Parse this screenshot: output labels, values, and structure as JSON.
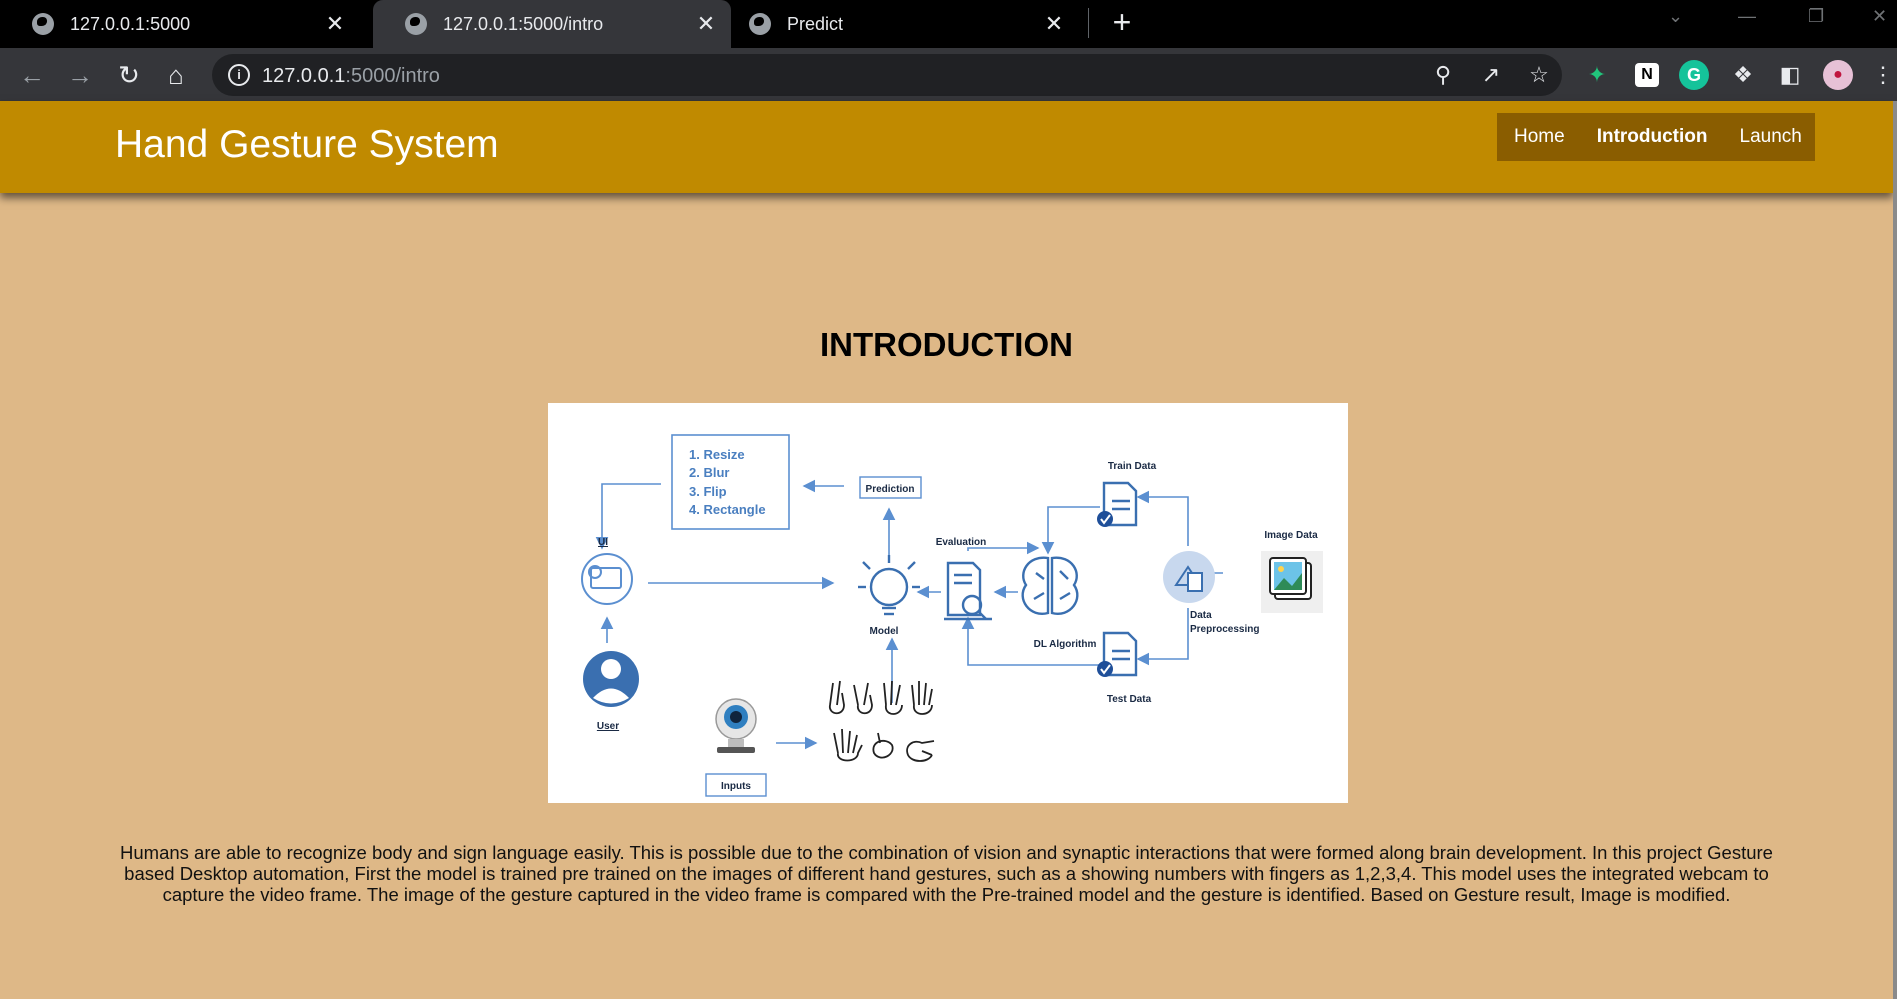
{
  "browser": {
    "tabs": [
      {
        "title": "127.0.0.1:5000",
        "close": "✕"
      },
      {
        "title": "127.0.0.1:5000/intro",
        "close": "✕"
      },
      {
        "title": "Predict",
        "close": "✕"
      }
    ],
    "new_tab": "+",
    "url_host": "127.0.0.1",
    "url_path": ":5000/intro"
  },
  "header": {
    "brand": "Hand Gesture System",
    "nav": [
      "Home",
      "Introduction",
      "Launch"
    ],
    "active": "Introduction"
  },
  "main": {
    "title": "INTRODUCTION",
    "figure": {
      "steps": [
        "1. Resize",
        "2. Blur",
        "3. Flip",
        "4. Rectangle"
      ],
      "prediction": "Prediction",
      "ui": "UI",
      "user": "User",
      "model": "Model",
      "evaluation": "Evaluation",
      "dl_algorithm": "DL Algorithm",
      "train_data": "Train Data",
      "test_data": "Test Data",
      "image_data": "Image Data",
      "data_preprocessing_1": "Data",
      "data_preprocessing_2": "Preprocessing",
      "inputs": "Inputs"
    },
    "description": "Humans are able to recognize body and sign language easily. This is possible due to the combination of vision and synaptic interactions that were formed along brain development. In this project Gesture based Desktop automation, First the model is trained pre trained on the images of different hand gestures, such as a showing numbers with fingers as 1,2,3,4. This model uses the integrated webcam to capture the video frame. The image of the gesture captured in the video frame is compared with the Pre-trained model and the gesture is identified. Based on Gesture result, Image is modified."
  },
  "colors": {
    "page_bg": "#deb887",
    "header_bg": "#c08a00",
    "nav_bg": "#8a5d00",
    "diagram_blue": "#3a6fb0"
  }
}
